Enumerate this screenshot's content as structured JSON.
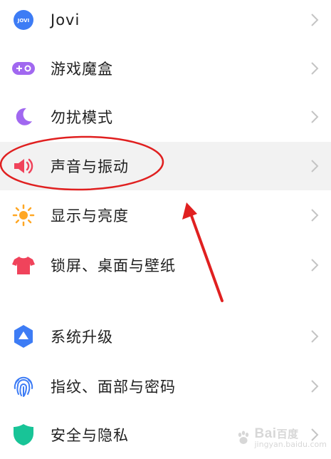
{
  "settings": {
    "items": [
      {
        "label": "Jovi",
        "icon": "jovi-icon"
      },
      {
        "label": "游戏魔盒",
        "icon": "game-box-icon"
      },
      {
        "label": "勿扰模式",
        "icon": "moon-icon"
      },
      {
        "label": "声音与振动",
        "icon": "speaker-icon"
      },
      {
        "label": "显示与亮度",
        "icon": "sun-icon"
      },
      {
        "label": "锁屏、桌面与壁纸",
        "icon": "tshirt-icon"
      },
      {
        "label": "系统升级",
        "icon": "system-update-icon"
      },
      {
        "label": "指纹、面部与密码",
        "icon": "fingerprint-icon"
      },
      {
        "label": "安全与隐私",
        "icon": "shield-icon"
      }
    ],
    "highlighted_item": "声音与振动"
  },
  "icons": {
    "jovi_text": "JOVI"
  },
  "annotation": {
    "circle_color": "#e02020",
    "arrow_color": "#e02020"
  },
  "watermark": {
    "brand": "Bai",
    "brand_suffix": "百度",
    "sub": "jingyan.baidu.com"
  },
  "colors": {
    "jovi": "#3d7cf5",
    "game": "#a168f0",
    "moon": "#a168f0",
    "speaker": "#f0435b",
    "sun": "#ffa724",
    "tshirt": "#f0435b",
    "update": "#3d7cf5",
    "fingerprint": "#3d7cf5",
    "shield": "#18c497"
  }
}
